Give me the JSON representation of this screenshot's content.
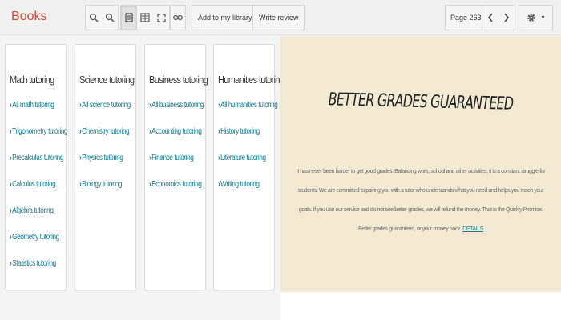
{
  "toolbar": {
    "brand": "Books",
    "add_to_library_label": "Add to my library",
    "write_review_label": "Write review",
    "page_label": "Page 263"
  },
  "cards": [
    {
      "title": "Math tutoring",
      "links": [
        "All math tutoring",
        "Trigonometry tutoring",
        "Precalculus tutoring",
        "Calculus tutoring",
        "Algebra tutoring",
        "Geometry tutoring",
        "Statistics tutoring"
      ]
    },
    {
      "title": "Science tutoring",
      "links": [
        "All science tutoring",
        "Chemistry tutoring",
        "Physics tutoring",
        "Biology tutoring"
      ]
    },
    {
      "title": "Business tutoring",
      "links": [
        "All business tutoring",
        "Accounting tutoring",
        "Finance tutoring",
        "Economics tutoring"
      ]
    },
    {
      "title": "Humanities tutoring",
      "links": [
        "All humanities tutoring",
        "History tutoring",
        "Literature tutoring",
        "Writing tutoring"
      ]
    }
  ],
  "promo": {
    "headline": "BETTER GRADES GUARANTEED",
    "body": "It has never been harder to get good grades. Balancing work, school and other activities, it is a constant struggle for students. We are committed to pairing you with a tutor who understands what you need and helps you reach your goals. If you use our service and do not see better grades, we will refund the money. That is the Quickly Promise. Better grades guaranteed, or your money back.",
    "link": "DETAILS"
  },
  "colors": {
    "brand": "#dd4b39",
    "link": "#157a8c",
    "promo_bg": "#f3ead3"
  }
}
